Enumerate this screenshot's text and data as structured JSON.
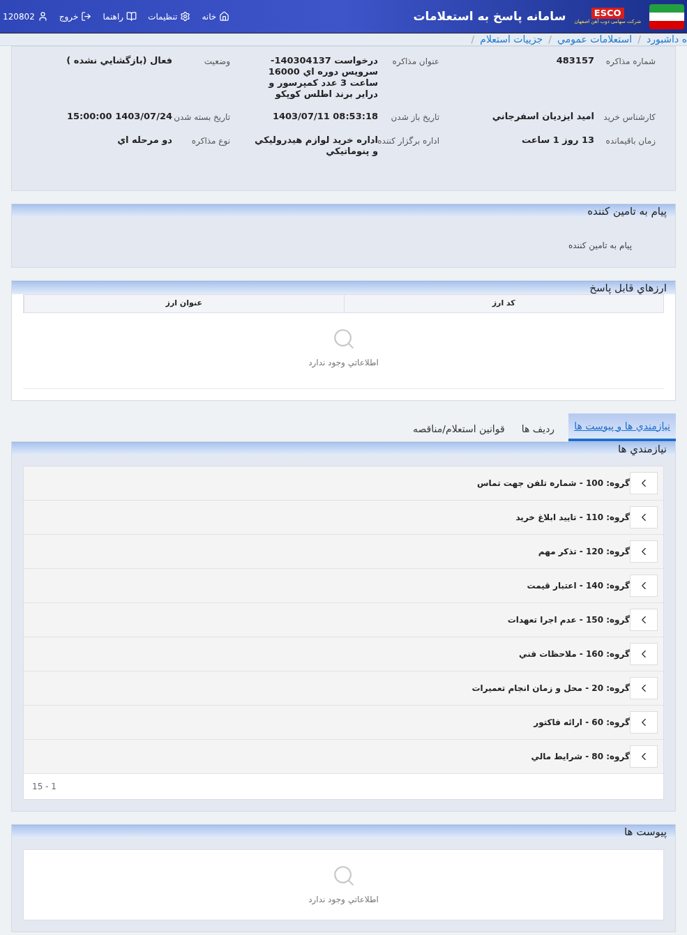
{
  "header": {
    "title": "سامانه پاسخ به استعلامات",
    "logo_text": "ESCO",
    "logo_subtitle": "شرکت سهامی ذوب آهن اصفهان",
    "user": "120802",
    "menu": [
      {
        "kind": "home",
        "label": "خانه"
      },
      {
        "kind": "settings",
        "label": "تنظیمات"
      },
      {
        "kind": "help",
        "label": "راهنما"
      },
      {
        "kind": "logout",
        "label": "خروج"
      }
    ]
  },
  "breadcrumb": {
    "separator": "/",
    "items": [
      "ه داشبورد",
      "استعلامات عمومي",
      "جزييات استعلام"
    ]
  },
  "details": [
    {
      "label": "شماره مذاکره",
      "value": "483157"
    },
    {
      "label": "عنوان مذاکره",
      "value": "درخواست 140304137-سرويس دوره اي 16000 ساعت 3 عدد کمپرسور و درایر برند اطلس کوپکو"
    },
    {
      "label": "وضعيت",
      "value": "فعال (بازگشايي نشده )"
    },
    {
      "label": "کارشناس خريد",
      "value": "اميد ايزديان اسفرجاني"
    },
    {
      "label": "تاريخ باز شدن",
      "value": "08:53:18 1403/07/11"
    },
    {
      "label": "تاريخ بسته شدن",
      "value": "1403/07/24 15:00:00"
    },
    {
      "label": "زمان باقيمانده",
      "value": "13 روز 1 ساعت"
    },
    {
      "label": "اداره برگزار کننده",
      "value": "اداره خريد لوازم هيدروليکي و پنوماتيکي"
    },
    {
      "label": "نوع مذاکره",
      "value": "دو مرحله اي"
    }
  ],
  "message_section": {
    "title": "پيام به تامين کننده",
    "text": "پيام به تامين کننده"
  },
  "currencies": {
    "title": "ارزهاي قابل پاسخ",
    "columns": [
      "کد ارز",
      "عنوان ارز"
    ],
    "empty": "اطلاعاتي وجود ندارد"
  },
  "tabs": [
    {
      "label": "نيازمندي ها و پيوست ها",
      "selected": true
    },
    {
      "label": "رديف ها",
      "selected": false
    },
    {
      "label": "قوانين استعلام/مناقصه",
      "selected": false
    }
  ],
  "requirements": {
    "title": "نيازمندي ها",
    "groups": [
      "گروه: 100 - شماره تلفن جهت تماس",
      "گروه: 110 - تاييد ابلاغ خريد",
      "گروه: 120 - تذکر مهم",
      "گروه: 140 - اعتبار قيمت",
      "گروه: 150 - عدم اجرا تعهدات",
      "گروه: 160 - ملاحظات فني",
      "گروه: 20 - محل و زمان انجام تعميرات",
      "گروه: 60 - ارائه فاکتور",
      "گروه: 80 - شرايط مالي"
    ],
    "pagination": "15 - 1"
  },
  "attachments": {
    "title": "پيوست ها",
    "empty": "اطلاعاتي وجود ندارد"
  }
}
